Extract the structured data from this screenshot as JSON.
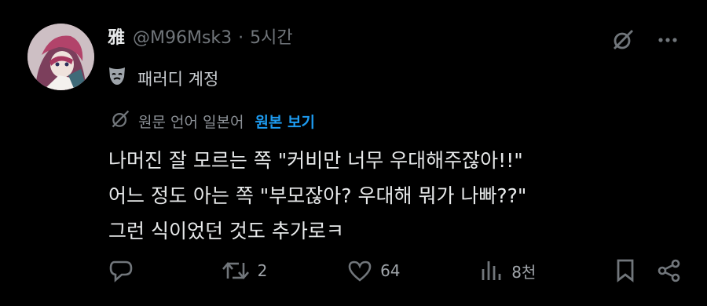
{
  "author": {
    "display_name": "雅",
    "handle": "@M96Msk3",
    "separator": "·",
    "time": "5시간"
  },
  "parody_label": "패러디 계정",
  "translation": {
    "meta": "원문 언어 일본어",
    "link": "원본 보기"
  },
  "body_lines": [
    "나머진 잘 모르는 쪽 \"커비만 너무 우대해주잖아!!\"",
    "어느 정도 아는 쪽 \"부모잖아? 우대해 뭐가 나빠??\"",
    "그런 식이었던 것도 추가로ㅋ"
  ],
  "actions": {
    "replies": "",
    "reposts": "2",
    "likes": "64",
    "views": "8천"
  },
  "icons": {
    "grok": "grok-icon",
    "more": "more-icon",
    "mask": "mask-icon",
    "reply": "reply-icon",
    "repost": "repost-icon",
    "like": "heart-icon",
    "views": "views-icon",
    "bookmark": "bookmark-icon",
    "share": "share-icon"
  },
  "colors": {
    "background": "#000000",
    "text": "#e7e9ea",
    "muted": "#71767b",
    "link": "#1d9bf0"
  }
}
